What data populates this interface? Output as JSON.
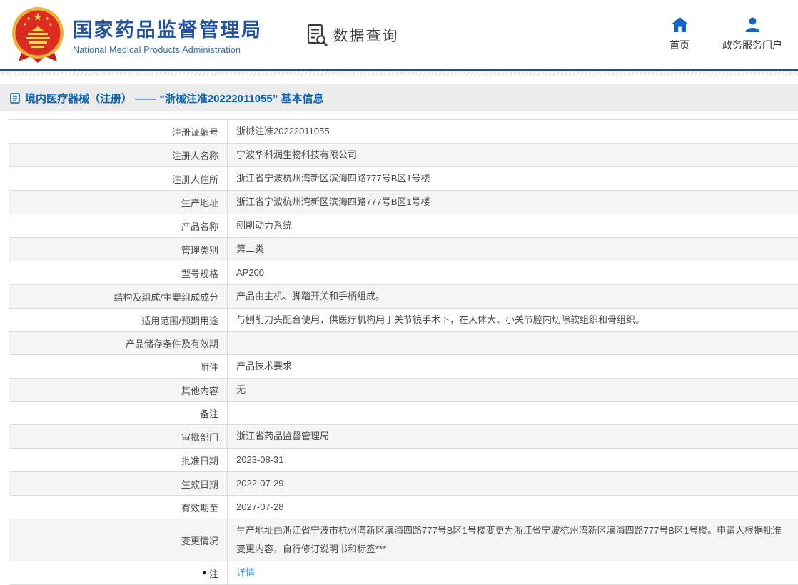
{
  "header": {
    "logo": {
      "title_cn": "国家药品监督管理局",
      "title_en": "National Medical Products Administration"
    },
    "section_label": "数据查询",
    "nav": [
      {
        "label": "首页",
        "icon": "home-icon"
      },
      {
        "label": "政务服务门户",
        "icon": "user-icon"
      }
    ]
  },
  "title_bar": {
    "icon": "document-icon",
    "text": "境内医疗器械（注册） —— “浙械注准20222011055” 基本信息"
  },
  "table": {
    "rows": [
      {
        "label": "注册证编号",
        "value": "浙械注准20222011055"
      },
      {
        "label": "注册人名称",
        "value": "宁波华科润生物科技有限公司"
      },
      {
        "label": "注册人住所",
        "value": "浙江省宁波杭州湾新区滨海四路777号B区1号楼"
      },
      {
        "label": "生产地址",
        "value": "浙江省宁波杭州湾新区滨海四路777号B区1号楼"
      },
      {
        "label": "产品名称",
        "value": "刨削动力系统"
      },
      {
        "label": "管理类别",
        "value": "第二类"
      },
      {
        "label": "型号规格",
        "value": "AP200"
      },
      {
        "label": "结构及组成/主要组成成分",
        "value": "产品由主机、脚踏开关和手柄组成。"
      },
      {
        "label": "适用范围/预期用途",
        "value": "与刨削刀头配合使用，供医疗机构用于关节镜手术下，在人体大、小关节腔内切除软组织和骨组织。"
      },
      {
        "label": "产品储存条件及有效期",
        "value": ""
      },
      {
        "label": "附件",
        "value": "产品技术要求"
      },
      {
        "label": "其他内容",
        "value": "无"
      },
      {
        "label": "备注",
        "value": ""
      },
      {
        "label": "审批部门",
        "value": "浙江省药品监督管理局"
      },
      {
        "label": "批准日期",
        "value": "2023-08-31"
      },
      {
        "label": "生效日期",
        "value": "2022-07-29"
      },
      {
        "label": "有效期至",
        "value": "2027-07-28"
      },
      {
        "label": "变更情况",
        "value": "生产地址由浙江省宁波市杭州湾新区滨海四路777号B区1号楼变更为浙江省宁波杭州湾新区滨海四路777号B区1号楼。申请人根据批准变更内容，自行修订说明书和标签***"
      },
      {
        "label": "注",
        "bullet": "●",
        "value": "详情",
        "link": true
      }
    ]
  },
  "colors": {
    "brand_blue": "#2453a4",
    "title_blue": "#0a64b0",
    "link_blue": "#3d9bea",
    "nav_icon_blue": "#1665c1",
    "emblem_red": "#dd2b21",
    "emblem_gold": "#e9b23c",
    "row_alt_bg": "#f5f5f5",
    "border_gray": "#dcdcdc"
  }
}
